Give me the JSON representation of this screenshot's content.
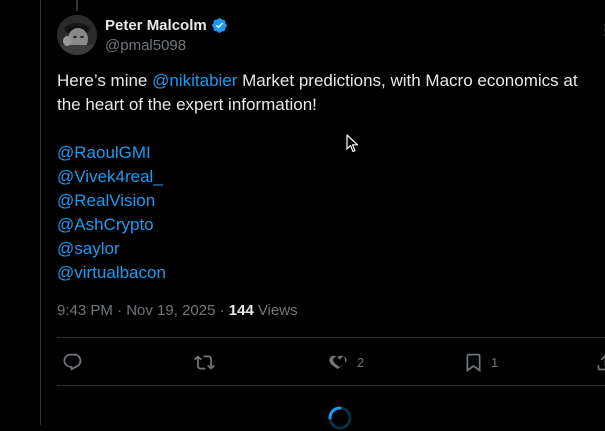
{
  "author": {
    "display_name": "Peter Malcolm",
    "handle": "@pmal5098",
    "verified": true
  },
  "tweet": {
    "text_before": "Here’s mine ",
    "inline_mention": "@nikitabier",
    "text_after": " Market predictions, with Macro economics at the heart of the expert information!",
    "mentions": [
      "@RaoulGMI",
      "@Vivek4real_",
      "@RealVision",
      "@AshCrypto",
      "@saylor",
      "@virtualbacon"
    ]
  },
  "meta": {
    "time": "9:43 PM",
    "separator": " · ",
    "date": "Nov 19, 2025",
    "views_count": "144",
    "views_label": "Views"
  },
  "actions": {
    "reply_count": "",
    "retweet_count": "",
    "like_count": "2",
    "bookmark_count": "1"
  },
  "colors": {
    "background": "#000000",
    "text": "#e7e9ea",
    "muted": "#71767b",
    "link": "#1d9bf0",
    "border": "#2f3336",
    "verified": "#1d9bf0"
  },
  "icons": [
    "verified-badge-icon",
    "more-icon",
    "reply-icon",
    "retweet-icon",
    "like-icon",
    "bookmark-icon",
    "share-icon",
    "loading-spinner-icon",
    "mouse-cursor-icon"
  ]
}
